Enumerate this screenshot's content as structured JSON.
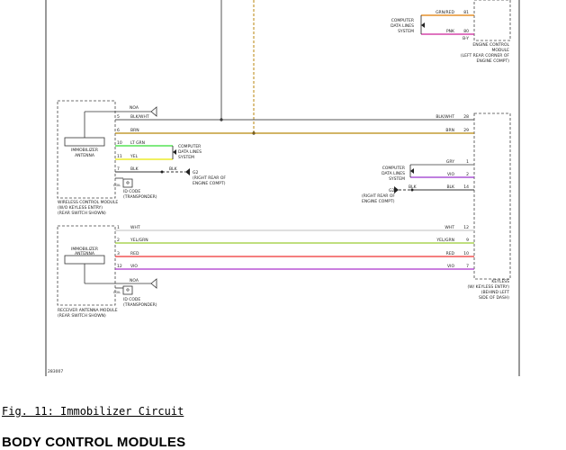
{
  "caption": "Fig. 11: Immobilizer Circuit",
  "section_title": "BODY CONTROL MODULES",
  "diagram": {
    "page_code": "283007",
    "modules": {
      "wireless": "WIRELESS CONTROL MODULE\n(W/O KEYLESS ENTRY)\n(REAR SWITCH SHOWN)",
      "receiver": "RECEIVER ANTENNA MODULE\n(REAR SWITCH SHOWN)",
      "engine_control": "ENGINE CONTROL\nMODULE\n(LEFT REAR CORNER OF\nENGINE COMPT)",
      "keyless": "KEYLESS\n(W/ KEYLESS ENTRY)\n(BEHIND LEFT\nSIDE OF DASH)"
    },
    "labels": {
      "antenna": "IMMOBILIZER\nANTENNA",
      "id_code": "ID CODE\n(TRANSPONDER)",
      "data_lines": "COMPUTER\nDATA LINES\nSYSTEM",
      "g2_right": "G2\n(RIGHT REAR OF\nENGINE COMPT)",
      "g2_left": "G2\n(RIGHT REAR OF\nENGINE COMPT)",
      "noa": "NOA",
      "coil": "COIL"
    },
    "ecm_wires": [
      {
        "color": "GRN/RED",
        "pin": "81",
        "hex": "#e07b00"
      },
      {
        "color": "PNK",
        "pin": "80",
        "hex": "#cc2299"
      },
      {
        "color": "",
        "pin": "B-Y",
        "hex": "#555555"
      }
    ],
    "wireless_wires": [
      {
        "pin_left": "5",
        "color_left": "BLK/WHT",
        "color_right": "BLK/WHT",
        "pin_right": "28",
        "hex": "#555555"
      },
      {
        "pin_left": "6",
        "color_left": "BRN",
        "color_right": "BRN",
        "pin_right": "29",
        "hex": "#b8860b"
      },
      {
        "pin_left": "10",
        "color_left": "LT GRN",
        "color_right": "",
        "pin_right": "",
        "hex": "#33dd33"
      },
      {
        "pin_left": "11",
        "color_left": "YEL",
        "color_right": "",
        "pin_right": "",
        "hex": "#e6e600"
      },
      {
        "pin_left": "7",
        "color_left": "BLK",
        "color_right": "BLK",
        "pin_right": "",
        "hex": "#333333"
      }
    ],
    "keyless_inputs": [
      {
        "color": "GRY",
        "pin": "1",
        "hex": "#888888"
      },
      {
        "color": "VIO",
        "pin": "2",
        "hex": "#9933cc"
      },
      {
        "color": "BLK",
        "pin": "14",
        "hex": "#333333"
      }
    ],
    "receiver_wires": [
      {
        "pin_left": "1",
        "color_left": "WHT",
        "color_right": "WHT",
        "pin_right": "12",
        "hex": "#cccccc"
      },
      {
        "pin_left": "2",
        "color_left": "YEL/GRN",
        "color_right": "YEL/GRN",
        "pin_right": "9",
        "hex": "#99cc33"
      },
      {
        "pin_left": "3",
        "color_left": "RED",
        "color_right": "RED",
        "pin_right": "10",
        "hex": "#ee3333"
      },
      {
        "pin_left": "12",
        "color_left": "VIO",
        "color_right": "VIO",
        "pin_right": "7",
        "hex": "#aa33cc"
      }
    ]
  }
}
